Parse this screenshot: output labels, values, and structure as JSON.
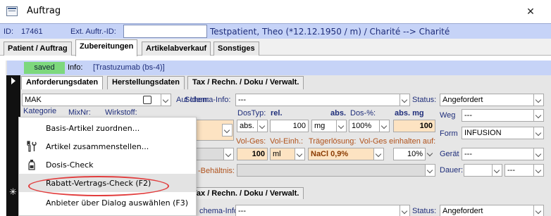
{
  "window": {
    "title": "Auftrag",
    "close": "✕"
  },
  "header": {
    "id_label": "ID:",
    "id_value": "17461",
    "extid_label": "Ext. Auftr.-ID:",
    "extid_value": "",
    "patient": "Testpatient, Theo (*12.12.1950 / m)  /  Charité --> Charité"
  },
  "top_tabs": [
    "Patient / Auftrag",
    "Zubereitungen",
    "Artikelabverkauf",
    "Sonstiges"
  ],
  "status": {
    "badge": "saved",
    "badge_color": "#7dd87d",
    "info_label": "Info:",
    "info_value": "[Trastuzumab (bs-4)]"
  },
  "sub_tabs": [
    "Anforderungsdaten",
    "Herstellungsdaten",
    "Tax / Rechn. / Doku / Verwalt."
  ],
  "form": {
    "article": "MAK",
    "aut_idem": "Aut Idem:",
    "schema_info_label": "Schema-Info:",
    "schema_info_value": "---",
    "status_label": "Status:",
    "status_value": "Angefordert",
    "kategorie": "Kategorie",
    "mixnr": "MixNr:",
    "wirkstoff": "Wirkstoff:",
    "dostyp_label": "DosTyp:",
    "rel": "rel.",
    "abs": "abs.",
    "dos_pct_label": "Dos-%:",
    "abs_mg": "abs. mg",
    "dostyp_value": "abs.",
    "dose": "100",
    "unit": "mg",
    "pct": "100%",
    "abs_mg_value": "100",
    "weg_label": "Weg",
    "weg_value": "---",
    "form_label": "Form",
    "form_value": "INFUSION",
    "volges_label": "Vol-Ges:",
    "voleinh_label": "Vol-Einh.:",
    "traeger_label": "Trägerlösung:",
    "volges_ein_label": "Vol-Ges einhalten auf:",
    "volges_value": "100",
    "voleinh_value": "ml",
    "traeger_value": "NaCl 0,9%",
    "einhalten_value": "10%",
    "geraet_label": "Gerät",
    "geraet_value": "---",
    "dauer_label": "Dauer:",
    "dauer_unit": "---",
    "verhaeltnis_label": "-Behältnis:"
  },
  "row2": {
    "marker": "✳",
    "tab": "Tax / Rechn. / Doku / Verwalt.",
    "schema_info_label": "chema-Info:",
    "schema_info_value": "---",
    "status_label": "Status:",
    "status_value": "Angefordert"
  },
  "context_menu": [
    {
      "icon": "none",
      "label": "Basis-Artikel zuordnen..."
    },
    {
      "icon": "tools-icon",
      "label": "Artikel zusammenstellen..."
    },
    {
      "icon": "bottle-icon",
      "label": "Dosis-Check"
    },
    {
      "icon": "none",
      "label": "Rabatt-Vertrags-Check (F2)"
    },
    {
      "icon": "none",
      "label": "Anbieter über Dialog auswählen (F3)"
    }
  ]
}
